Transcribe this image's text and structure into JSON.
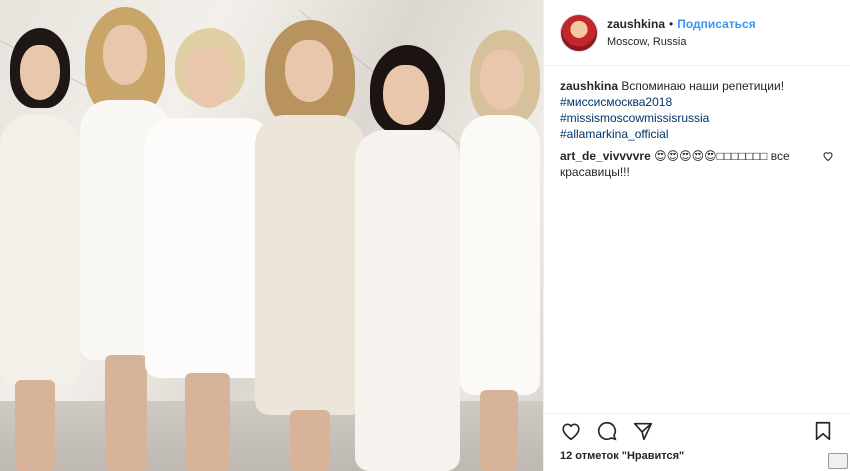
{
  "post": {
    "username": "zaushkina",
    "separator": "•",
    "follow_label": "Подписаться",
    "location": "Moscow, Russia"
  },
  "caption": {
    "username": "zaushkina",
    "text": "Вспоминаю наши репетиции!",
    "hashtags": [
      "#миссисмосква2018",
      "#missismoscowmissisrussia",
      "#allamarkina_official"
    ]
  },
  "comments": [
    {
      "username": "art_de_vivvvvre",
      "text": "😍😍😍😍😍□□□□□□□ все красавицы!!!"
    }
  ],
  "likes_text": "12 отметок \"Нравится\"",
  "icons": {
    "like": "heart-icon",
    "comment": "comment-icon",
    "share": "share-icon",
    "save": "bookmark-icon"
  },
  "colors": {
    "link": "#3897f0",
    "hashtag": "#003569",
    "text": "#262626"
  }
}
